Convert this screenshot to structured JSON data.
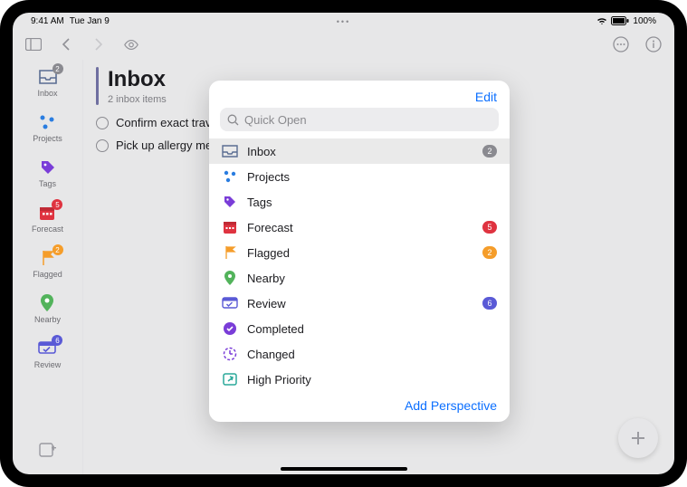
{
  "statusbar": {
    "time": "9:41 AM",
    "date": "Tue Jan 9",
    "battery": "100%"
  },
  "page": {
    "title": "Inbox",
    "subtitle": "2 inbox items"
  },
  "tasks": [
    {
      "text": "Confirm exact travel dates"
    },
    {
      "text": "Pick up allergy medication"
    }
  ],
  "sidebar": {
    "items": [
      {
        "label": "Inbox",
        "badge": "2",
        "badge_color": "grey"
      },
      {
        "label": "Projects"
      },
      {
        "label": "Tags"
      },
      {
        "label": "Forecast",
        "badge": "5",
        "badge_color": "red"
      },
      {
        "label": "Flagged",
        "badge": "2",
        "badge_color": "orange"
      },
      {
        "label": "Nearby"
      },
      {
        "label": "Review",
        "badge": "6",
        "badge_color": "purple"
      }
    ]
  },
  "popover": {
    "edit": "Edit",
    "search_placeholder": "Quick Open",
    "items": [
      {
        "label": "Inbox",
        "badge": "2",
        "badge_color": "grey",
        "selected": true
      },
      {
        "label": "Projects"
      },
      {
        "label": "Tags"
      },
      {
        "label": "Forecast",
        "badge": "5",
        "badge_color": "red"
      },
      {
        "label": "Flagged",
        "badge": "2",
        "badge_color": "orange"
      },
      {
        "label": "Nearby"
      },
      {
        "label": "Review",
        "badge": "6",
        "badge_color": "purple"
      },
      {
        "label": "Completed"
      },
      {
        "label": "Changed"
      },
      {
        "label": "High Priority"
      }
    ],
    "footer": "Add Perspective"
  },
  "colors": {
    "accent": "#0b6fff",
    "purple": "#7a3dd8",
    "teal": "#2aa89a",
    "orange": "#f59d2a",
    "red": "#df3340",
    "green": "#52b35b",
    "navy": "#5a6d92",
    "blue": "#2a7de0"
  }
}
